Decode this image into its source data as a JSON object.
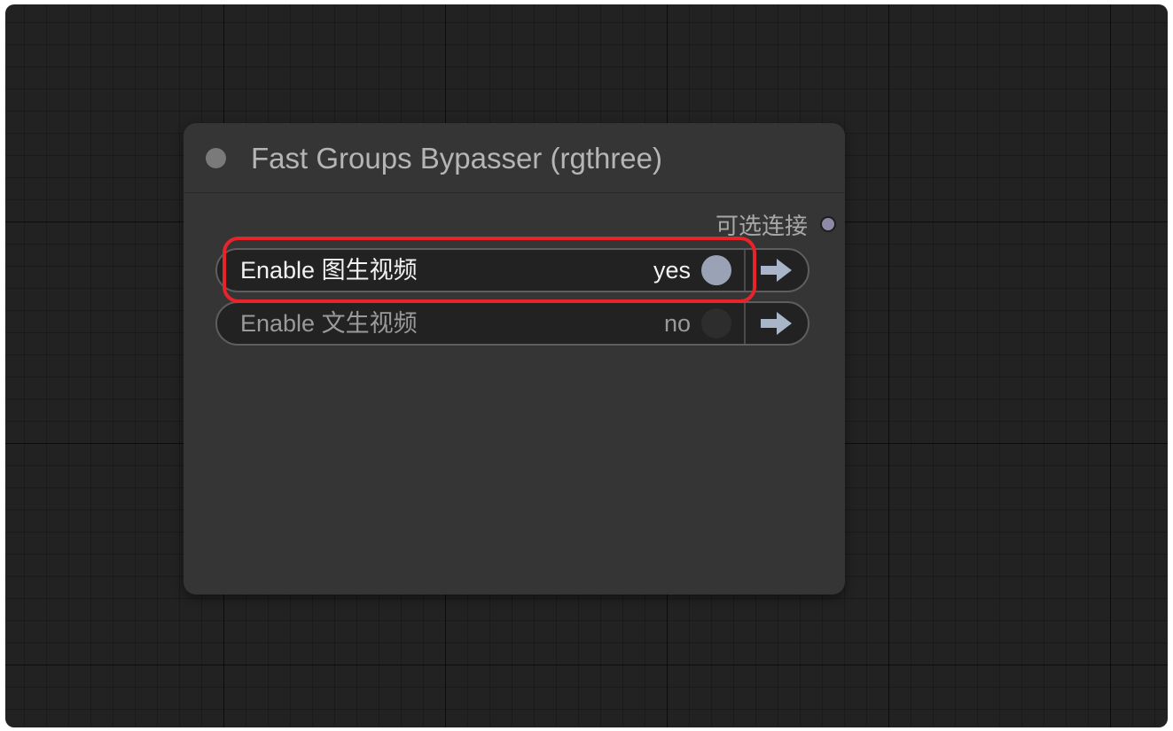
{
  "node": {
    "title": "Fast Groups Bypasser (rgthree)",
    "output_label": "可选连接"
  },
  "toggles": [
    {
      "label": "Enable 图生视频",
      "state": "yes",
      "enabled": true
    },
    {
      "label": "Enable 文生视频",
      "state": "no",
      "enabled": false
    }
  ],
  "colors": {
    "canvas_bg": "#222222",
    "node_bg": "#353535",
    "knob_on": "#9aa3b5",
    "arrow": "#a9b5c9",
    "highlight": "#e8232a"
  },
  "icons": {
    "nav": "arrow-right-icon",
    "status": "circle-icon"
  }
}
